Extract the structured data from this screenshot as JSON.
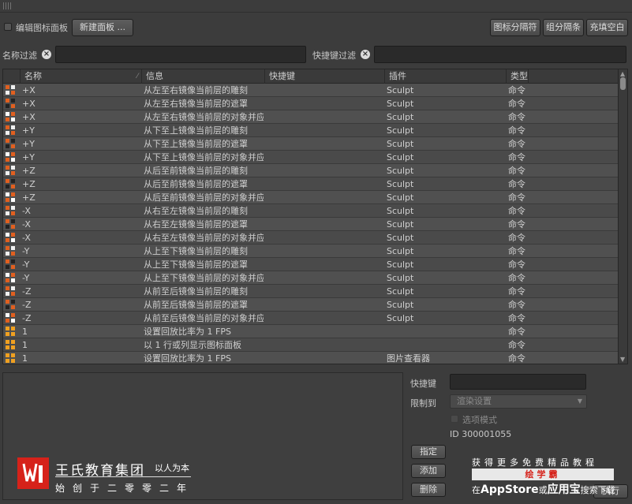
{
  "toolbar": {
    "edit_panel_label": "编辑图标面板",
    "new_panel_button": "新建面板 ...",
    "icon_separator_button": "图标分隔符",
    "group_separator_button": "组分隔条",
    "fill_blank_button": "充填空白"
  },
  "filters": {
    "name_filter_label": "名称过滤",
    "shortcut_filter_label": "快捷键过滤",
    "name_filter_value": "",
    "shortcut_filter_value": ""
  },
  "table": {
    "columns": [
      "名称",
      "信息",
      "快捷键",
      "插件",
      "类型"
    ],
    "rows": [
      {
        "name": "+X",
        "info": "从左至右镜像当前层的雕刻",
        "shortcut": "",
        "plugin": "Sculpt",
        "type": "命令",
        "icon": "mirror-x-sculpt-icon"
      },
      {
        "name": "+X",
        "info": "从左至右镜像当前层的遮罩",
        "shortcut": "",
        "plugin": "Sculpt",
        "type": "命令",
        "icon": "mirror-x-mask-icon"
      },
      {
        "name": "+X",
        "info": "从左至右镜像当前层的对象并应",
        "shortcut": "",
        "plugin": "Sculpt",
        "type": "命令",
        "icon": "mirror-x-object-icon"
      },
      {
        "name": "+Y",
        "info": "从下至上镜像当前层的雕刻",
        "shortcut": "",
        "plugin": "Sculpt",
        "type": "命令",
        "icon": "mirror-y-sculpt-icon"
      },
      {
        "name": "+Y",
        "info": "从下至上镜像当前层的遮罩",
        "shortcut": "",
        "plugin": "Sculpt",
        "type": "命令",
        "icon": "mirror-y-mask-icon"
      },
      {
        "name": "+Y",
        "info": "从下至上镜像当前层的对象并应",
        "shortcut": "",
        "plugin": "Sculpt",
        "type": "命令",
        "icon": "mirror-y-object-icon"
      },
      {
        "name": "+Z",
        "info": "从后至前镜像当前层的雕刻",
        "shortcut": "",
        "plugin": "Sculpt",
        "type": "命令",
        "icon": "mirror-z-sculpt-icon"
      },
      {
        "name": "+Z",
        "info": "从后至前镜像当前层的遮罩",
        "shortcut": "",
        "plugin": "Sculpt",
        "type": "命令",
        "icon": "mirror-z-mask-icon"
      },
      {
        "name": "+Z",
        "info": "从后至前镜像当前层的对象并应",
        "shortcut": "",
        "plugin": "Sculpt",
        "type": "命令",
        "icon": "mirror-z-object-icon"
      },
      {
        "name": "-X",
        "info": "从右至左镜像当前层的雕刻",
        "shortcut": "",
        "plugin": "Sculpt",
        "type": "命令",
        "icon": "mirror-x-sculpt-icon"
      },
      {
        "name": "-X",
        "info": "从右至左镜像当前层的遮罩",
        "shortcut": "",
        "plugin": "Sculpt",
        "type": "命令",
        "icon": "mirror-x-mask-icon"
      },
      {
        "name": "-X",
        "info": "从右至左镜像当前层的对象并应",
        "shortcut": "",
        "plugin": "Sculpt",
        "type": "命令",
        "icon": "mirror-x-object-icon"
      },
      {
        "name": "-Y",
        "info": "从上至下镜像当前层的雕刻",
        "shortcut": "",
        "plugin": "Sculpt",
        "type": "命令",
        "icon": "mirror-y-sculpt-icon"
      },
      {
        "name": "-Y",
        "info": "从上至下镜像当前层的遮罩",
        "shortcut": "",
        "plugin": "Sculpt",
        "type": "命令",
        "icon": "mirror-y-mask-icon"
      },
      {
        "name": "-Y",
        "info": "从上至下镜像当前层的对象并应",
        "shortcut": "",
        "plugin": "Sculpt",
        "type": "命令",
        "icon": "mirror-y-object-icon"
      },
      {
        "name": "-Z",
        "info": "从前至后镜像当前层的雕刻",
        "shortcut": "",
        "plugin": "Sculpt",
        "type": "命令",
        "icon": "mirror-z-sculpt-icon"
      },
      {
        "name": "-Z",
        "info": "从前至后镜像当前层的遮罩",
        "shortcut": "",
        "plugin": "Sculpt",
        "type": "命令",
        "icon": "mirror-z-mask-icon"
      },
      {
        "name": "-Z",
        "info": "从前至后镜像当前层的对象并应",
        "shortcut": "",
        "plugin": "Sculpt",
        "type": "命令",
        "icon": "mirror-z-object-icon"
      },
      {
        "name": "1",
        "info": "设置回放比率为 1 FPS",
        "shortcut": "",
        "plugin": "",
        "type": "命令",
        "icon": "playback-rate-icon"
      },
      {
        "name": "1",
        "info": "以 1 行或列显示图标面板",
        "shortcut": "",
        "plugin": "",
        "type": "命令",
        "icon": "one-column-icon"
      },
      {
        "name": "1",
        "info": "设置回放比率为 1 FPS",
        "shortcut": "",
        "plugin": "图片查看器",
        "type": "命令",
        "icon": "playback-rate-icon"
      }
    ]
  },
  "details": {
    "shortcut_label": "快捷键",
    "restrict_label": "限制到",
    "restrict_value": "渲染设置",
    "option_mode_label": "选项模式",
    "id_text": "ID 300001055",
    "assign_button": "指定",
    "add_button": "添加",
    "delete_button": "删除",
    "execute_button": "执行"
  },
  "watermark": {
    "brand_name": "王氏教育集团",
    "slogan": "以人为本",
    "founded": "始创于二零零二年",
    "promo_line1": "获得更多免费精品教程",
    "promo_bar": "绘学霸",
    "promo_line3_pre": "在",
    "promo_line3_app": "AppStore",
    "promo_line3_mid": "或",
    "promo_line3_app2": "应用宝",
    "promo_line3_post": "搜索下载",
    "logo_color": "#d6221a"
  }
}
